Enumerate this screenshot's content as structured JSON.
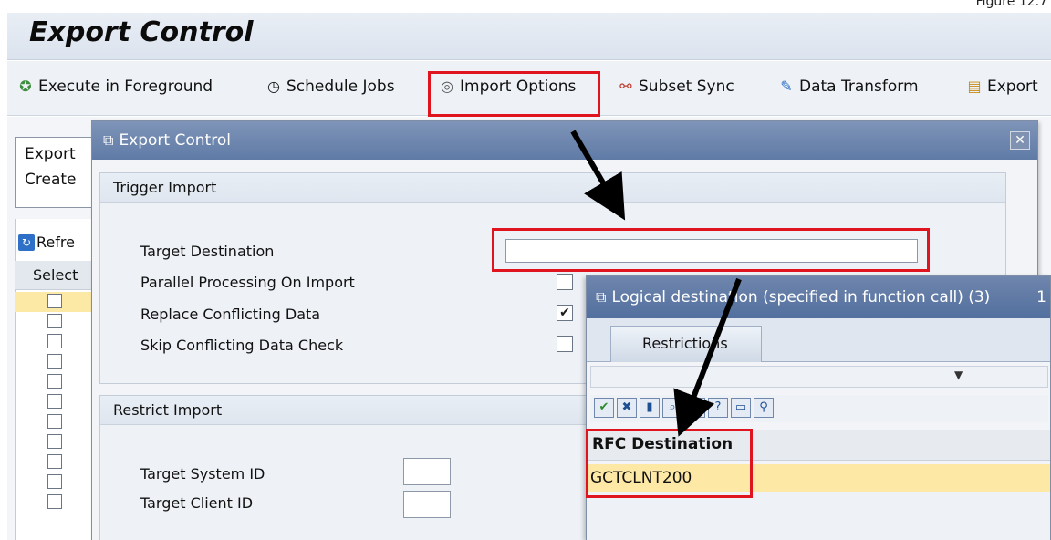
{
  "figure_label": "Figure 12.7",
  "window": {
    "title": "Export Control"
  },
  "toolbar": {
    "execute": "Execute in Foreground",
    "schedule": "Schedule Jobs",
    "import_options": "Import Options",
    "subset_sync": "Subset Sync",
    "data_transform": "Data Transform",
    "export": "Export"
  },
  "background": {
    "row1": "Export",
    "row2": "Create",
    "refresh": "Refre",
    "select_header": "Select"
  },
  "dialog": {
    "title": "Export Control",
    "trigger_group": "Trigger Import",
    "target_destination_label": "Target Destination",
    "target_destination_value": "",
    "parallel_label": "Parallel Processing On Import",
    "replace_label": "Replace Conflicting Data",
    "replace_checked": "✔",
    "skip_label": "Skip Conflicting Data Check",
    "restrict_group": "Restrict Import",
    "target_system_label": "Target System ID",
    "target_client_label": "Target Client ID"
  },
  "lookup": {
    "title": "Logical destination (specified in function call) (3)",
    "title_suffix": "1",
    "tab": "Restrictions",
    "column": "RFC Destination",
    "rows": [
      "GCTCLNT200"
    ]
  },
  "colors": {
    "highlight": "#e0141e",
    "selected_row": "#fde8a6",
    "title_bar": "#5f7ba6"
  }
}
